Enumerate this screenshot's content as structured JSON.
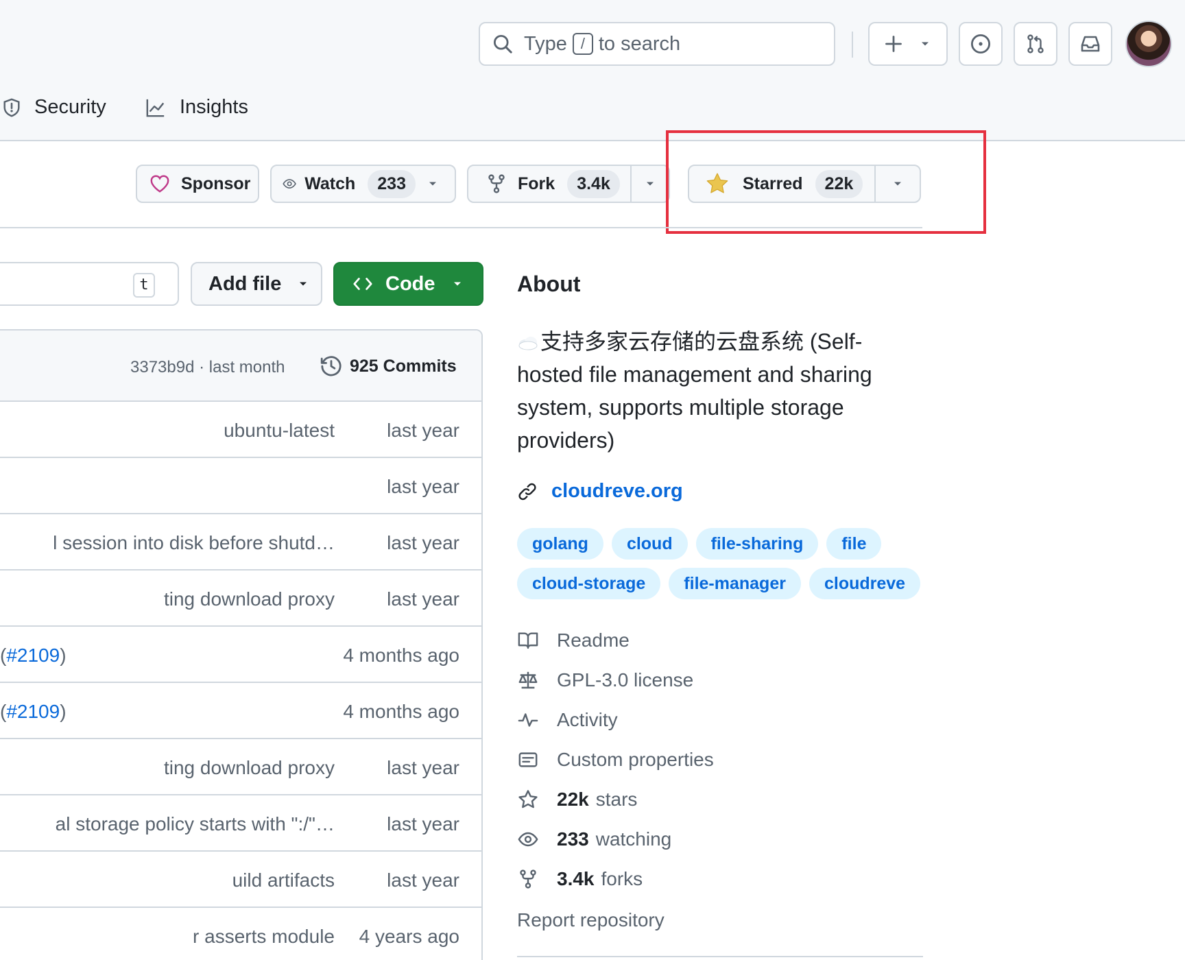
{
  "header": {
    "search": {
      "prefix": "Type",
      "key": "/",
      "suffix": "to search"
    }
  },
  "tabs": [
    {
      "label": "Security"
    },
    {
      "label": "Insights"
    }
  ],
  "actions": {
    "sponsor": "Sponsor",
    "watch": {
      "label": "Watch",
      "count": "233"
    },
    "fork": {
      "label": "Fork",
      "count": "3.4k"
    },
    "star": {
      "label": "Starred",
      "count": "22k"
    }
  },
  "files": {
    "go_to_file_key": "t",
    "add_file": "Add file",
    "code": "Code",
    "latest_commit": {
      "sha": "3373b9d · last month",
      "commits": "925 Commits"
    },
    "rows": [
      {
        "msg": "ubuntu-latest",
        "age": "last year"
      },
      {
        "msg": "",
        "age": "last year"
      },
      {
        "msg": "l session into disk before shutd…",
        "age": "last year"
      },
      {
        "msg": "ting download proxy",
        "age": "last year"
      },
      {
        "msg_pre": "(",
        "msg_link": "#2109",
        "msg_post": ")",
        "age": "4 months ago"
      },
      {
        "msg_pre": "(",
        "msg_link": "#2109",
        "msg_post": ")",
        "age": "4 months ago"
      },
      {
        "msg": "ting download proxy",
        "age": "last year"
      },
      {
        "msg": "al storage policy starts with \":/\"…",
        "age": "last year"
      },
      {
        "msg": "uild artifacts",
        "age": "last year"
      },
      {
        "msg": "r asserts module",
        "age": "4 years ago"
      }
    ]
  },
  "about": {
    "title": "About",
    "description": "支持多家云存储的云盘系统 (Self-hosted file management and sharing system, supports multiple storage providers)",
    "homepage": "cloudreve.org",
    "topics": [
      "golang",
      "cloud",
      "file-sharing",
      "file",
      "cloud-storage",
      "file-manager",
      "cloudreve"
    ],
    "readme": "Readme",
    "license": "GPL-3.0 license",
    "activity": "Activity",
    "custom_properties": "Custom properties",
    "stars": {
      "count": "22k",
      "label": "stars"
    },
    "watching": {
      "count": "233",
      "label": "watching"
    },
    "forks": {
      "count": "3.4k",
      "label": "forks"
    },
    "report": "Report repository"
  },
  "colors": {
    "accent": "#0969da",
    "primary_button": "#1f883d",
    "highlight": "#e5303f",
    "star": "#eac54f",
    "heart": "#bf3989"
  }
}
